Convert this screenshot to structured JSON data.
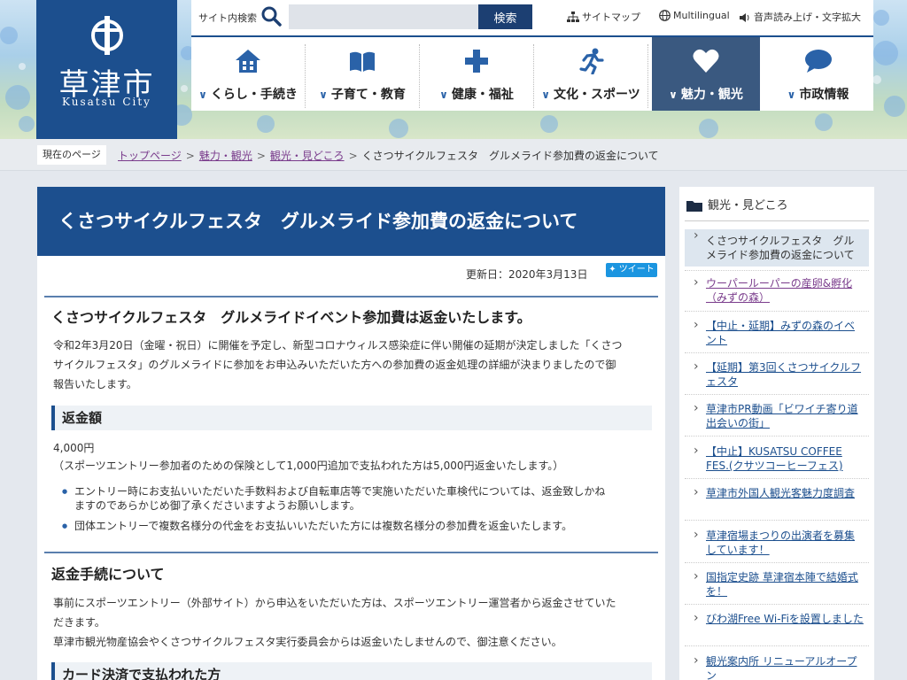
{
  "header": {
    "logo_name": "草津市",
    "logo_roman": "Kusatsu City",
    "search_label": "サイト内検索",
    "search_placeholder": "",
    "search_button": "検索",
    "links": {
      "sitemap": "サイトマップ",
      "multilingual": "Multilingual",
      "accessibility": "音声読み上げ・文字拡大"
    },
    "nav": [
      {
        "label": "くらし・手続き",
        "icon": "house-icon"
      },
      {
        "label": "子育て・教育",
        "icon": "book-icon"
      },
      {
        "label": "健康・福祉",
        "icon": "plus-icon"
      },
      {
        "label": "文化・スポーツ",
        "icon": "runner-icon"
      },
      {
        "label": "魅力・観光",
        "icon": "heart-icon",
        "active": true
      },
      {
        "label": "市政情報",
        "icon": "speech-bubble-icon"
      }
    ],
    "accent": "#1c4f8e"
  },
  "breadcrumb": {
    "here": "現在のページ",
    "items": [
      "トップページ",
      "魅力・観光",
      "観光・見どころ"
    ],
    "current": "くさつサイクルフェスタ　グルメライド参加費の返金について"
  },
  "article": {
    "title": "くさつサイクルフェスタ　グルメライド参加費の返金について",
    "updated": "更新日：2020年3月13日",
    "tweet": "ツイート",
    "heading": "くさつサイクルフェスタ　グルメライドイベント参加費は返金いたします。",
    "intro_1": "令和2年3月20日（金曜・祝日）に開催を予定し、新型コロナウィルス感染症に伴い開催の延期が決定しました「くさつ",
    "intro_2": "サイクルフェスタ」のグルメライドに参加をお申込みいただいた方への参加費の返金処理の詳細が決まりましたので御",
    "intro_3": "報告いたします。",
    "refund_heading": "返金額",
    "refund_amount": "4,000円",
    "refund_note": "（スポーツエントリー参加者のための保険として1,000円追加で支払われた方は5,000円返金いたします。）",
    "bullet_1a": "エントリー時にお支払いいただいた手数料および自転車店等で実施いただいた車検代については、返金致しかね",
    "bullet_1b": "ますのであらかじめ御了承くださいますようお願いします。",
    "bullet_2": "団体エントリーで複数名様分の代金をお支払いいただいた方には複数名様分の参加費を返金いたします。",
    "procedure_heading": "返金手続について",
    "procedure_1": "事前にスポーツエントリー（外部サイト）から申込をいただいた方は、スポーツエントリー運営者から返金させていた",
    "procedure_2": "だきます。",
    "procedure_3": "草津市観光物産協会やくさつサイクルフェスタ実行委員会からは返金いたしませんので、御注意ください。",
    "card_heading": "カード決済で支払われた方"
  },
  "sidebar": {
    "heading": "観光・見どころ",
    "items": [
      {
        "label": "くさつサイクルフェスタ　グルメライド参加費の返金について",
        "current": true
      },
      {
        "label": "ウーパールーパーの産卵&孵化（みずの森）",
        "visited": true
      },
      {
        "label": "【中止・延期】みずの森のイベント"
      },
      {
        "label": "【延期】第3回くさつサイクルフェスタ"
      },
      {
        "label": "草津市PR動画「ビワイチ寄り道出会いの街」"
      },
      {
        "label": "【中止】KUSATSU COFFEE FES.(クサツコーヒーフェス)"
      },
      {
        "label": "草津市外国人観光客魅力度調査"
      },
      {
        "label": "草津宿場まつりの出演者を募集しています！"
      },
      {
        "label": "国指定史跡 草津宿本陣で結婚式を！"
      },
      {
        "label": "びわ湖Free Wi-Fiを設置しました"
      },
      {
        "label": "観光案内所 リニューアルオープン"
      }
    ]
  }
}
